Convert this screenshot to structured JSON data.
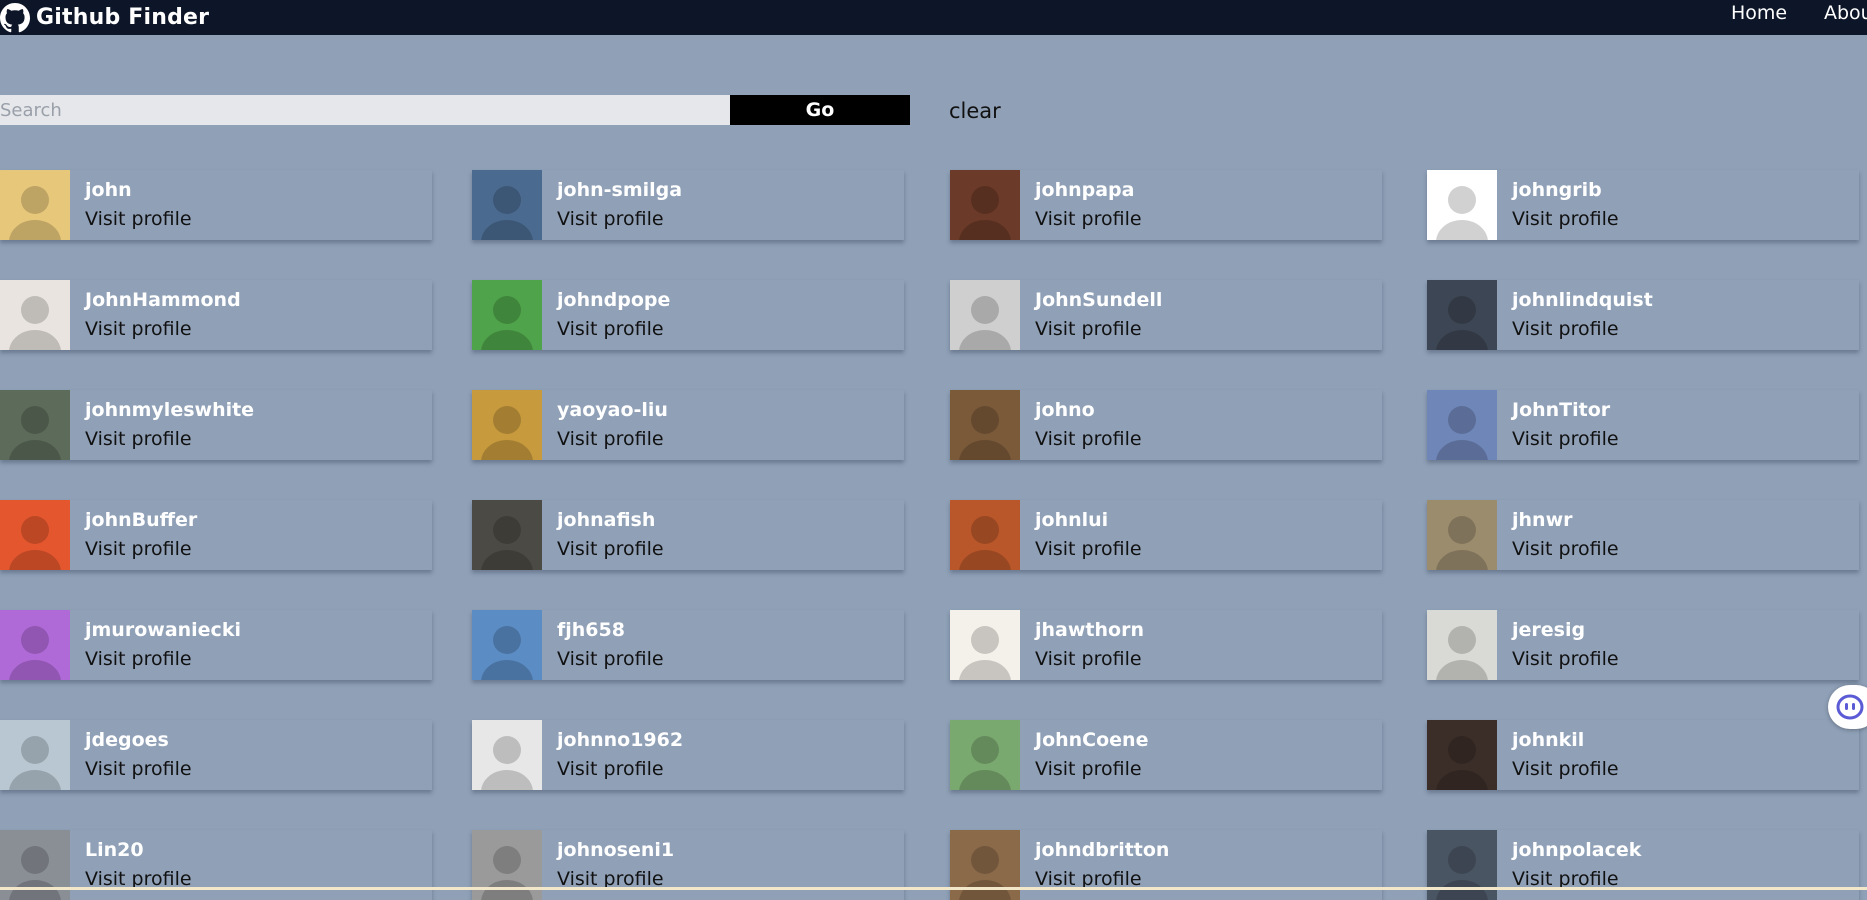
{
  "header": {
    "brand_icon": "github-icon",
    "title": "Github Finder",
    "nav": [
      {
        "label": "Home"
      },
      {
        "label": "About"
      }
    ]
  },
  "search": {
    "placeholder": "Search",
    "value": "",
    "go_label": "Go",
    "clear_label": "clear"
  },
  "colors": {
    "page_bg": "#8fa0b7",
    "navbar_bg": "#0d1628",
    "button_bg": "#000000",
    "username": "#ffffff"
  },
  "users": [
    {
      "login": "john",
      "link": "Visit profile",
      "avatar_color": "#e7c77a"
    },
    {
      "login": "john-smilga",
      "link": "Visit profile",
      "avatar_color": "#4a6a8f"
    },
    {
      "login": "johnpapa",
      "link": "Visit profile",
      "avatar_color": "#6b3a28"
    },
    {
      "login": "johngrib",
      "link": "Visit profile",
      "avatar_color": "#ffffff"
    },
    {
      "login": "JohnHammond",
      "link": "Visit profile",
      "avatar_color": "#e9e4e0"
    },
    {
      "login": "johndpope",
      "link": "Visit profile",
      "avatar_color": "#4fa34a"
    },
    {
      "login": "JohnSundell",
      "link": "Visit profile",
      "avatar_color": "#cfcfcf"
    },
    {
      "login": "johnlindquist",
      "link": "Visit profile",
      "avatar_color": "#3d4654"
    },
    {
      "login": "johnmyleswhite",
      "link": "Visit profile",
      "avatar_color": "#5c6b5a"
    },
    {
      "login": "yaoyao-liu",
      "link": "Visit profile",
      "avatar_color": "#c79a3d"
    },
    {
      "login": "johno",
      "link": "Visit profile",
      "avatar_color": "#7b5a3a"
    },
    {
      "login": "JohnTitor",
      "link": "Visit profile",
      "avatar_color": "#6f86b8"
    },
    {
      "login": "johnBuffer",
      "link": "Visit profile",
      "avatar_color": "#e4572e"
    },
    {
      "login": "johnafish",
      "link": "Visit profile",
      "avatar_color": "#4c4a44"
    },
    {
      "login": "johnlui",
      "link": "Visit profile",
      "avatar_color": "#b9572a"
    },
    {
      "login": "jhnwr",
      "link": "Visit profile",
      "avatar_color": "#9b8c6e"
    },
    {
      "login": "jmurowaniecki",
      "link": "Visit profile",
      "avatar_color": "#b06ad8"
    },
    {
      "login": "fjh658",
      "link": "Visit profile",
      "avatar_color": "#5b8cc4"
    },
    {
      "login": "jhawthorn",
      "link": "Visit profile",
      "avatar_color": "#f4f0ea"
    },
    {
      "login": "jeresig",
      "link": "Visit profile",
      "avatar_color": "#d9d9d6"
    },
    {
      "login": "jdegoes",
      "link": "Visit profile",
      "avatar_color": "#b9c7d2"
    },
    {
      "login": "johnno1962",
      "link": "Visit profile",
      "avatar_color": "#e7e7e7"
    },
    {
      "login": "JohnCoene",
      "link": "Visit profile",
      "avatar_color": "#7aa96f"
    },
    {
      "login": "johnkil",
      "link": "Visit profile",
      "avatar_color": "#3b2e28"
    },
    {
      "login": "Lin20",
      "link": "Visit profile",
      "avatar_color": "#8a8f96"
    },
    {
      "login": "johnoseni1",
      "link": "Visit profile",
      "avatar_color": "#9a9a9a"
    },
    {
      "login": "johndbritton",
      "link": "Visit profile",
      "avatar_color": "#8b6a4a"
    },
    {
      "login": "johnpolacek",
      "link": "Visit profile",
      "avatar_color": "#4a5563"
    }
  ]
}
